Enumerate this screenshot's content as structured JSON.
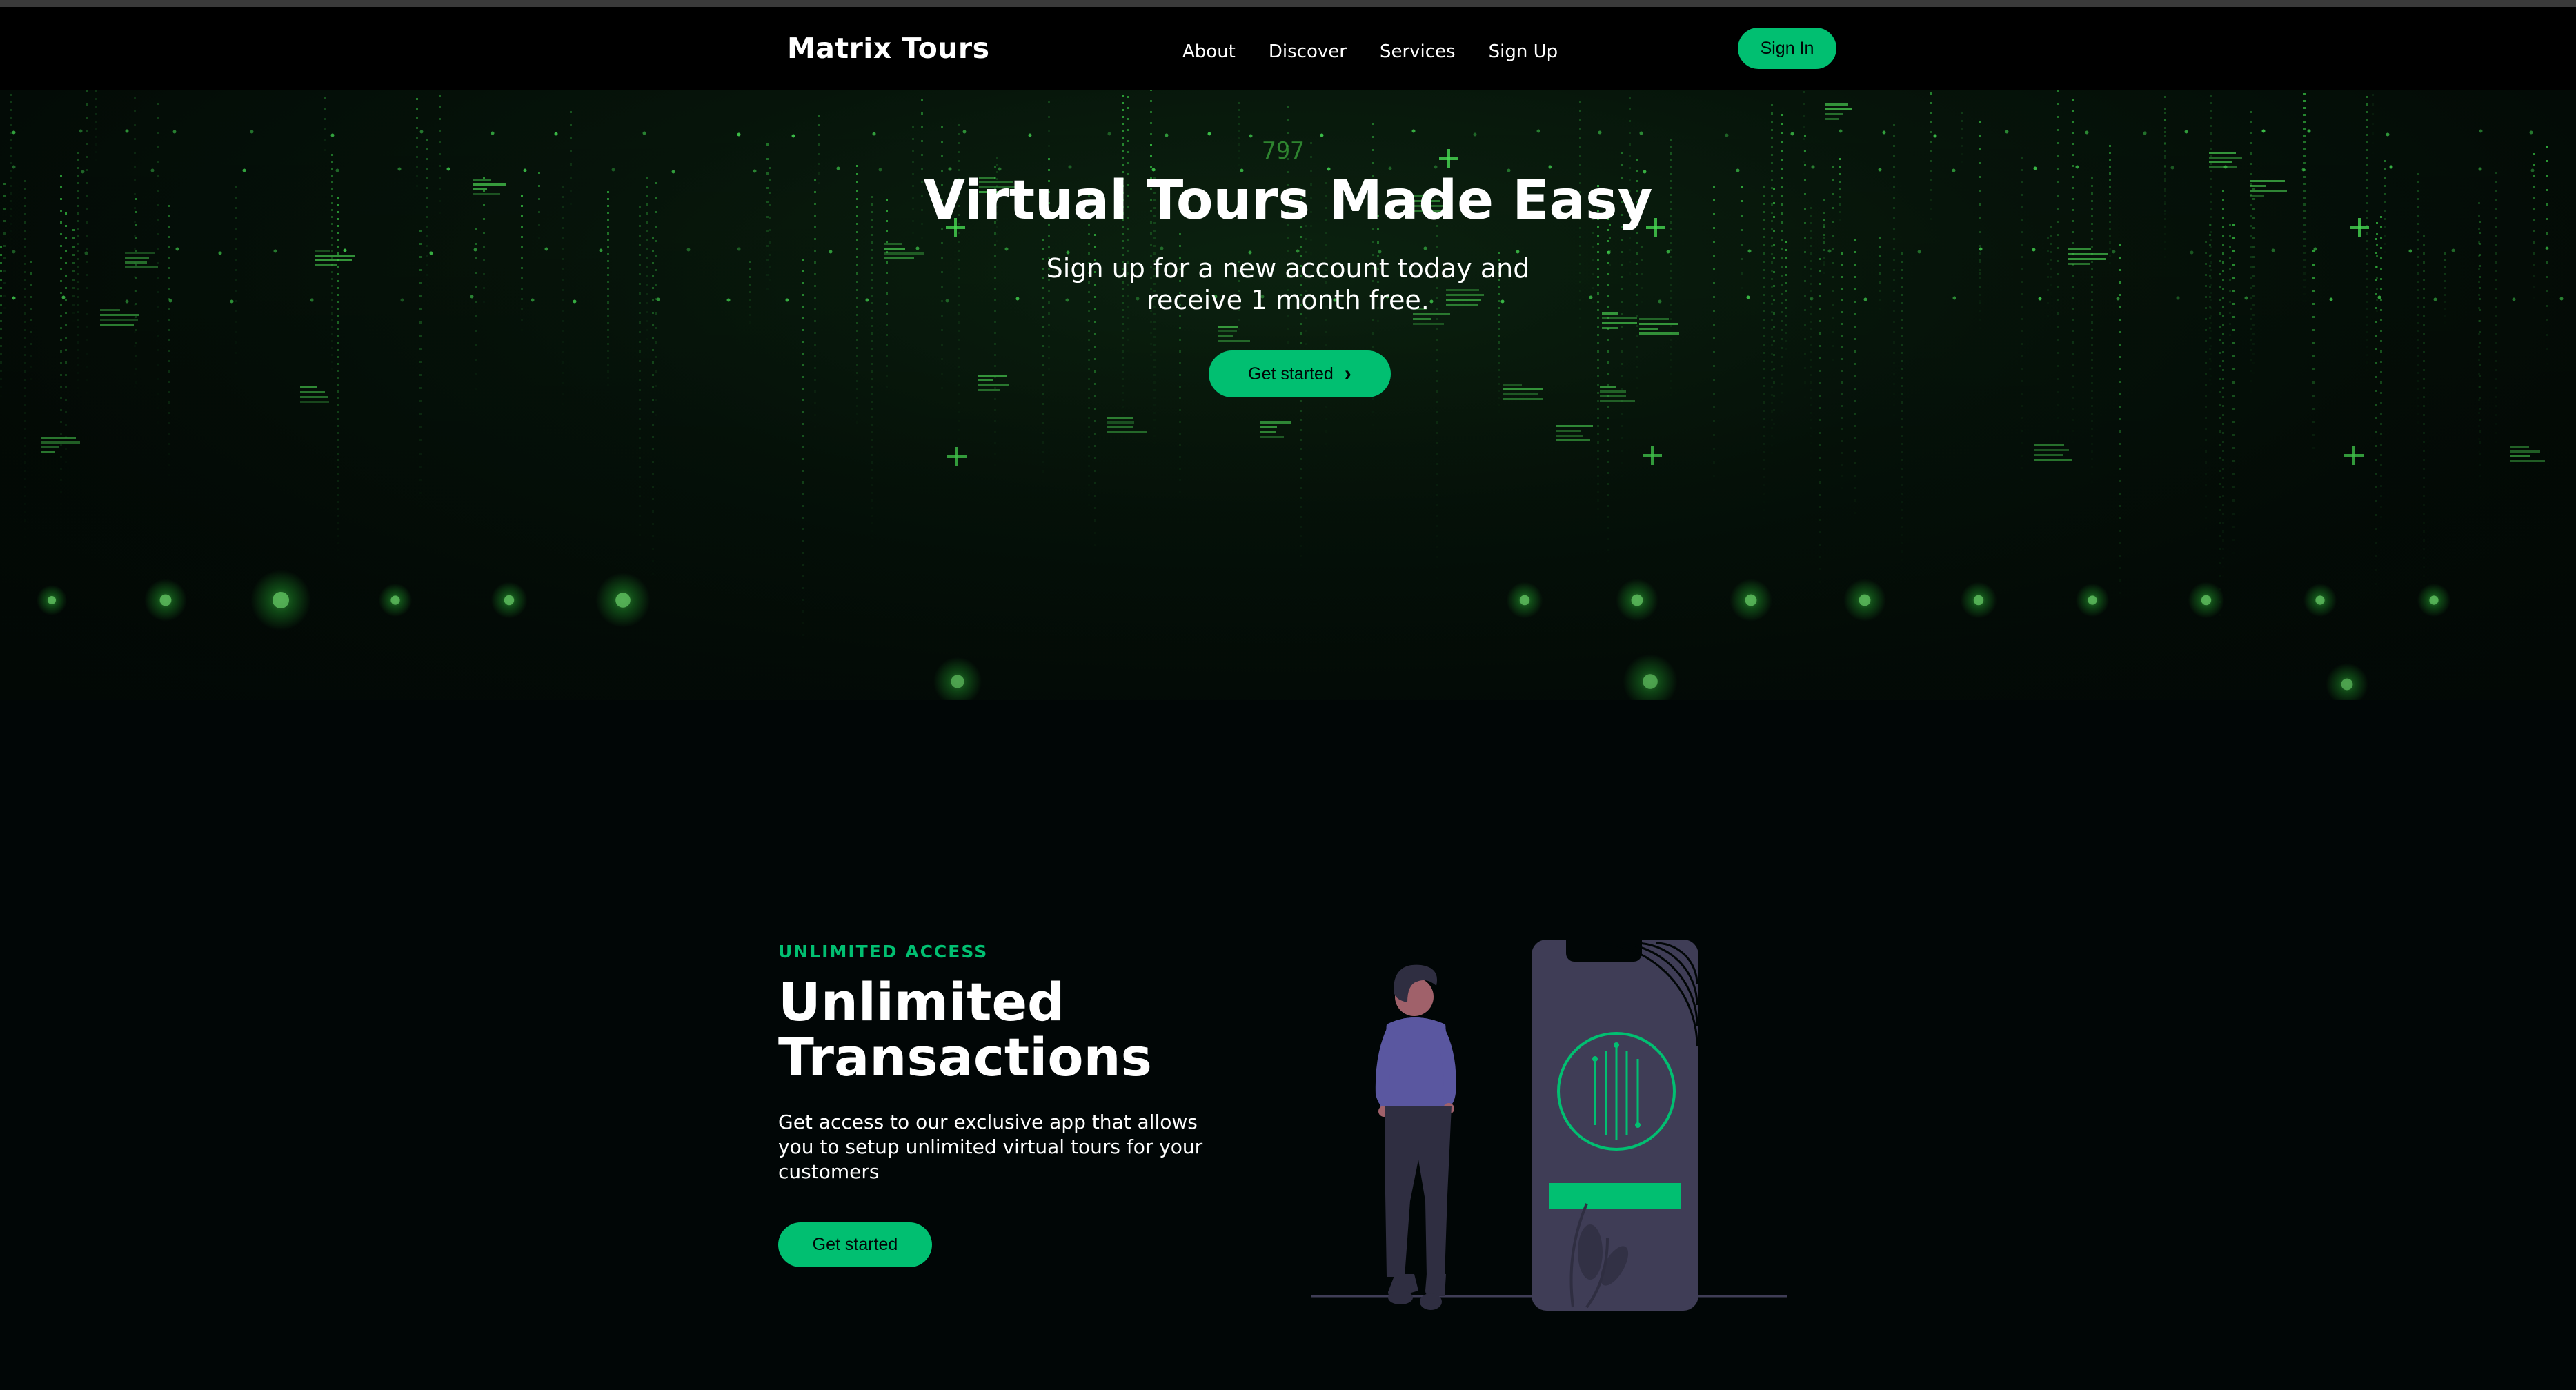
{
  "navbar": {
    "brand": "Matrix Tours",
    "links": [
      "About",
      "Discover",
      "Services",
      "Sign Up"
    ],
    "signin_label": "Sign In"
  },
  "hero": {
    "title": "Virtual Tours Made Easy",
    "subtitle": "Sign up for a new account today and receive 1 month free.",
    "cta_label": "Get started",
    "cta_icon": "chevron-right-icon",
    "bg_number": "797"
  },
  "info": {
    "top_line": "UNLIMITED ACCESS",
    "heading": "Unlimited Transactions",
    "description": "Get access to our exclusive app that allows you to setup unlimited virtual tours for your customers",
    "cta_label": "Get started",
    "illustration": "person-with-phone-illustration"
  },
  "colors": {
    "accent": "#01bf71",
    "navbar_bg": "#000000",
    "page_bg": "#010606",
    "hero_glow": "#2bd43a"
  }
}
